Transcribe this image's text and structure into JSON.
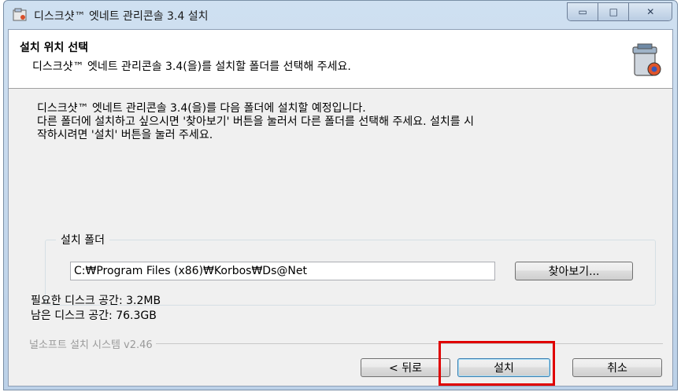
{
  "window": {
    "title": "디스크샷™ 엣네트 관리콘솔 3.4 설치",
    "controls": {
      "minimize": "▭",
      "maximize": "□",
      "close": "✕"
    }
  },
  "header": {
    "title": "설치 위치 선택",
    "subtitle": "디스크샷™ 엣네트 관리콘솔 3.4(을)를 설치할 폴더를 선택해 주세요."
  },
  "intro": {
    "line1": "디스크샷™ 엣네트 관리콘솔 3.4(을)를 다음 폴더에 설치할 예정입니다.",
    "line2": "다른 폴더에 설치하고 싶으시면 '찾아보기' 버튼을 눌러서 다른 폴더를 선택해 주세요. 설치를 시\n작하시려면 '설치' 버튼을 눌러 주세요."
  },
  "destination": {
    "group_label": "설치 폴더",
    "path_value": "C:₩Program Files (x86)₩Korbos₩Ds@Net",
    "browse_label": "찾아보기..."
  },
  "space": {
    "required": "필요한 디스크 공간: 3.2MB",
    "available": "남은 디스크 공간: 76.3GB"
  },
  "branding": "널소프트 설치 시스템 v2.46",
  "buttons": {
    "back": "< 뒤로",
    "install": "설치",
    "cancel": "취소"
  },
  "colors": {
    "highlight": "#e00000"
  }
}
